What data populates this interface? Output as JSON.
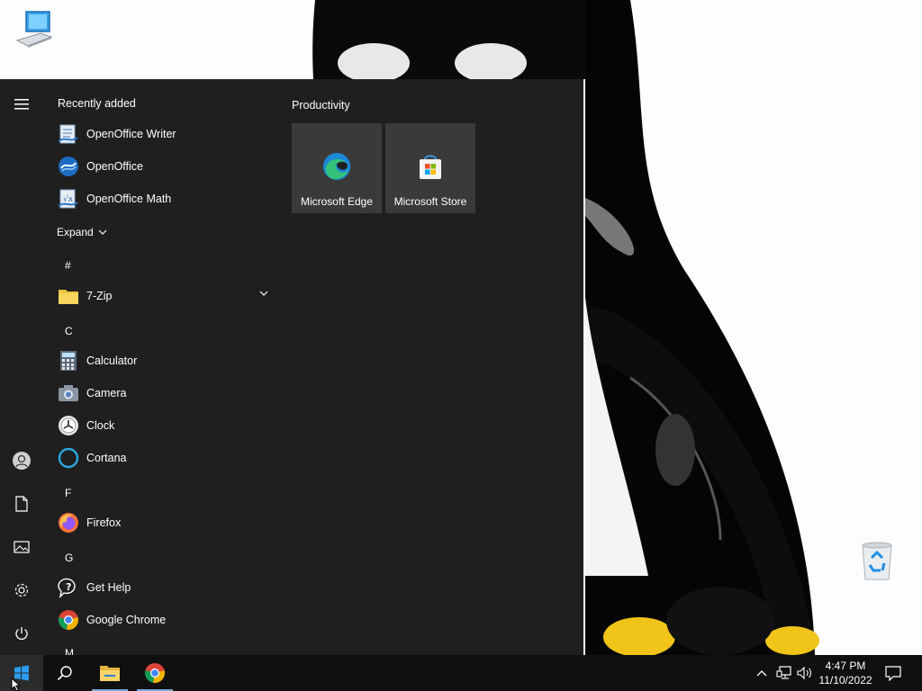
{
  "start_menu": {
    "recently_added_label": "Recently added",
    "recent": [
      {
        "label": "OpenOffice Writer",
        "icon": "openoffice-writer-icon"
      },
      {
        "label": "OpenOffice",
        "icon": "openoffice-icon"
      },
      {
        "label": "OpenOffice Math",
        "icon": "openoffice-math-icon"
      }
    ],
    "expand_label": "Expand",
    "groups": {
      "hash": "#",
      "c": "C",
      "f": "F",
      "g": "G",
      "m": "M"
    },
    "apps": {
      "seven_zip": "7-Zip",
      "calculator": "Calculator",
      "camera": "Camera",
      "clock": "Clock",
      "cortana": "Cortana",
      "firefox": "Firefox",
      "get_help": "Get Help",
      "google_chrome": "Google Chrome"
    },
    "tiles_group_title": "Productivity",
    "tiles": [
      {
        "label": "Microsoft Edge",
        "icon": "edge-icon"
      },
      {
        "label": "Microsoft Store",
        "icon": "store-icon"
      }
    ]
  },
  "taskbar": {
    "clock_time": "4:47 PM",
    "clock_date": "11/10/2022"
  },
  "colors": {
    "start_bg": "#1f1f1f",
    "tile_bg": "#3a3a3a",
    "taskbar_bg": "#101010",
    "accent": "#0078d7"
  }
}
